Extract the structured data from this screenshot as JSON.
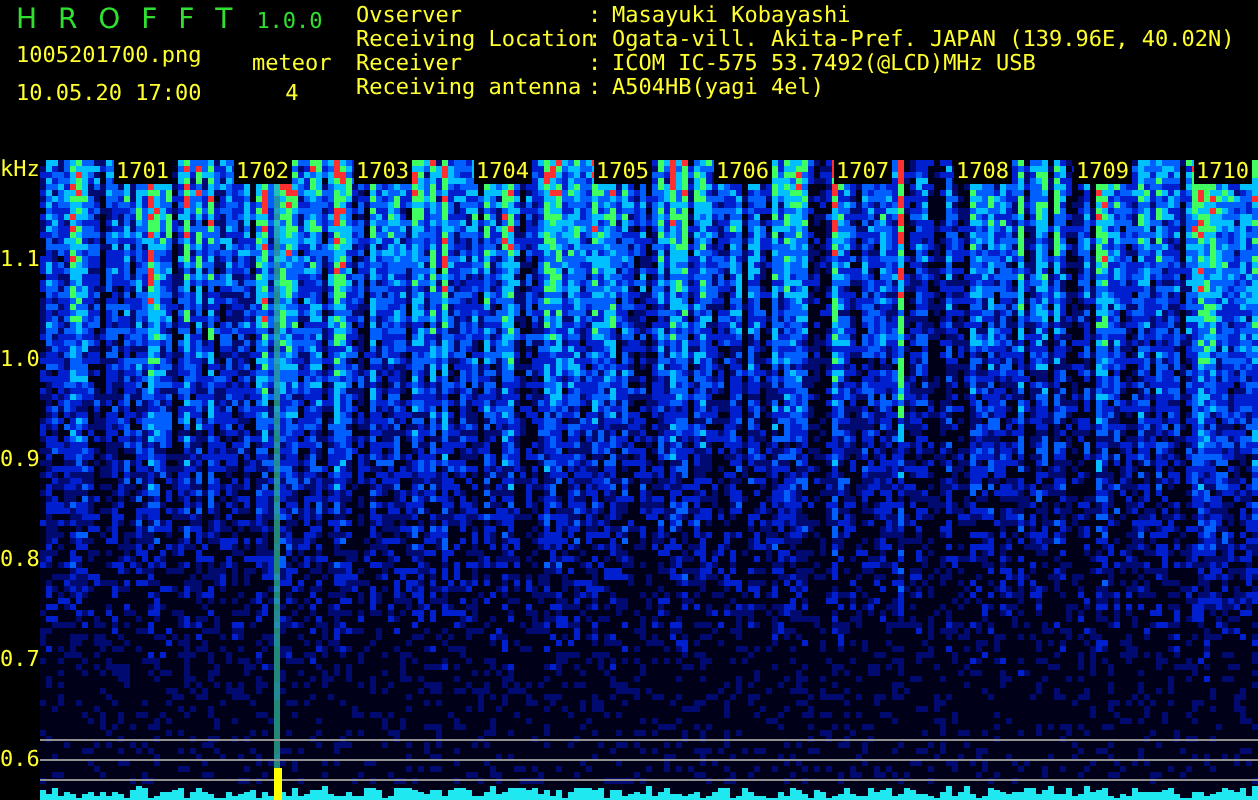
{
  "app": {
    "title": "H R O F F T",
    "version": "1.0.0",
    "filename": "1005201700.png",
    "datetime": "10.05.20 17:00",
    "counter_label": "meteor",
    "counter_value": "4"
  },
  "info": [
    {
      "label": "Ovserver",
      "value": "Masayuki Kobayashi"
    },
    {
      "label": "Receiving Location",
      "value": "Ogata-vill. Akita-Pref. JAPAN (139.96E, 40.02N)"
    },
    {
      "label": "Receiver",
      "value": "ICOM IC-575 53.7492(@LCD)MHz USB"
    },
    {
      "label": "Receiving antenna",
      "value": "A504HB(yagi 4el)"
    }
  ],
  "separator": ":",
  "plot": {
    "unit": "kHz",
    "time_labels": [
      "1701",
      "1702",
      "1703",
      "1704",
      "1705",
      "1706",
      "1707",
      "1708",
      "1709",
      "1710"
    ],
    "freq_labels": [
      "1.1",
      "1.0",
      "0.9",
      "0.8",
      "0.7",
      "0.6"
    ]
  }
}
